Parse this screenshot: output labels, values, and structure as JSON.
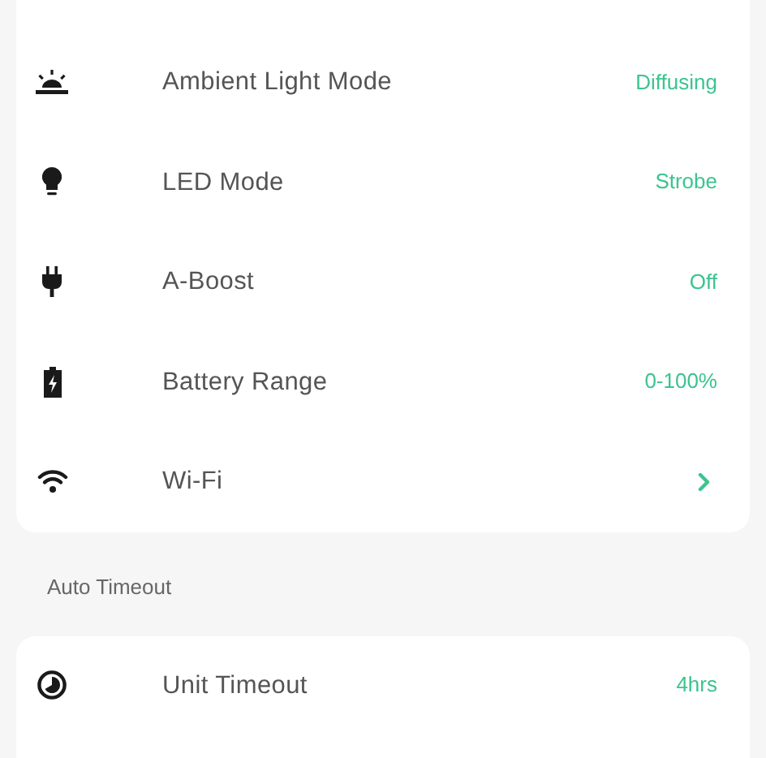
{
  "sections": [
    {
      "rows": [
        {
          "label": "Ambient Light Mode",
          "kind": "value",
          "value": "Diffusing"
        },
        {
          "label": "LED Mode",
          "kind": "value",
          "value": "Strobe"
        },
        {
          "label": "A-Boost",
          "kind": "value",
          "value": "Off"
        },
        {
          "label": "Battery Range",
          "kind": "value",
          "value": "0-100%"
        },
        {
          "label": "Wi-Fi",
          "kind": "link"
        }
      ]
    },
    {
      "header": "Auto Timeout",
      "rows": [
        {
          "label": "Unit Timeout",
          "kind": "value",
          "value": "4hrs"
        }
      ]
    }
  ]
}
